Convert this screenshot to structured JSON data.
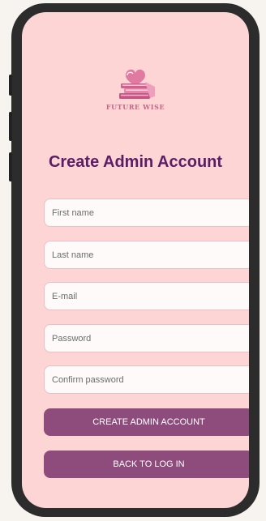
{
  "brand": {
    "logo_icon": "stacked-books-heart-icon",
    "name": "FUTURE WISE"
  },
  "page_title": "Create Admin Account",
  "form": {
    "first_name": {
      "placeholder": "First name",
      "value": ""
    },
    "last_name": {
      "placeholder": "Last name",
      "value": ""
    },
    "email": {
      "placeholder": "E-mail",
      "value": ""
    },
    "password": {
      "placeholder": "Password",
      "value": ""
    },
    "confirm_password": {
      "placeholder": "Confirm password",
      "value": ""
    }
  },
  "buttons": {
    "create_label": "CREATE ADMIN ACCOUNT",
    "back_label": "BACK TO LOG IN"
  },
  "colors": {
    "screen_background": "#fdd5d5",
    "title": "#5b1e66",
    "button": "#8e4c7c",
    "brand": "#c9648a",
    "phone_frame": "#2c2c2c"
  }
}
